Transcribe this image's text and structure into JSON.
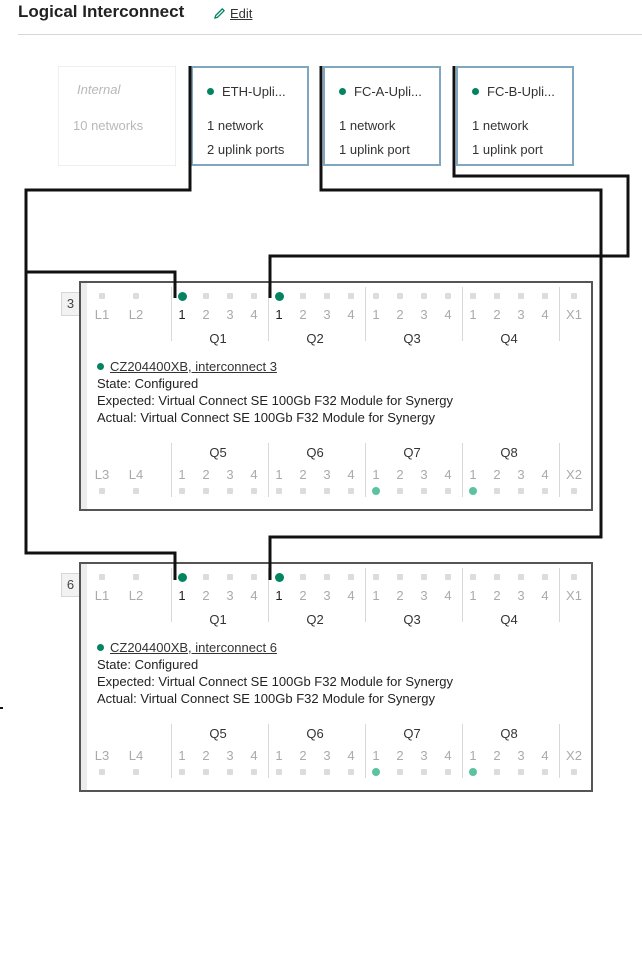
{
  "header": {
    "title": "Logical Interconnect",
    "edit_label": "Edit",
    "edit_icon": "pencil-icon"
  },
  "colors": {
    "status_ok": "#01845f",
    "uplink_tile_border": "#7fa7c0",
    "port_linked_light": "#5cc2a0",
    "wire": "#111111"
  },
  "uplink_sets": [
    {
      "name": "Internal",
      "networks": "10 networks",
      "ports": "",
      "type": "internal"
    },
    {
      "name": "ETH-Upli...",
      "networks": "1 network",
      "ports": "2 uplink ports",
      "status": "ok"
    },
    {
      "name": "FC-A-Upli...",
      "networks": "1 network",
      "ports": "1 uplink port",
      "status": "ok"
    },
    {
      "name": "FC-B-Upli...",
      "networks": "1 network",
      "ports": "1 uplink port",
      "status": "ok"
    }
  ],
  "modules": [
    {
      "slot": "3",
      "name": "CZ204400XB, interconnect 3",
      "state": "State: Configured",
      "expected": "Expected: Virtual Connect SE 100Gb F32 Module for Synergy",
      "actual": "Actual: Virtual Connect SE 100Gb F32 Module for Synergy",
      "top_groups": {
        "L1": "L1",
        "L2": "L2",
        "Q1": "Q1",
        "Q2": "Q2",
        "Q3": "Q3",
        "Q4": "Q4",
        "X1": "X1"
      },
      "bottom_groups": {
        "L3": "L3",
        "L4": "L4",
        "Q5": "Q5",
        "Q6": "Q6",
        "Q7": "Q7",
        "Q8": "Q8",
        "X2": "X2"
      },
      "uplinked_ports": [
        "Q1:1",
        "Q2:1"
      ],
      "linked_ports": [
        "Q7:1",
        "Q8:1"
      ]
    },
    {
      "slot": "6",
      "name": "CZ204400XB, interconnect 6",
      "state": "State: Configured",
      "expected": "Expected: Virtual Connect SE 100Gb F32 Module for Synergy",
      "actual": "Actual: Virtual Connect SE 100Gb F32 Module for Synergy",
      "top_groups": {
        "L1": "L1",
        "L2": "L2",
        "Q1": "Q1",
        "Q2": "Q2",
        "Q3": "Q3",
        "Q4": "Q4",
        "X1": "X1"
      },
      "bottom_groups": {
        "L3": "L3",
        "L4": "L4",
        "Q5": "Q5",
        "Q6": "Q6",
        "Q7": "Q7",
        "Q8": "Q8",
        "X2": "X2"
      },
      "uplinked_ports": [
        "Q1:1",
        "Q2:1"
      ],
      "linked_ports": [
        "Q7:1",
        "Q8:1"
      ]
    }
  ],
  "port_numbers": [
    "1",
    "2",
    "3",
    "4"
  ],
  "connections": [
    {
      "uplink_set": "ETH-Upli...",
      "to": [
        "interconnect 3 Q1:1",
        "interconnect 6 Q1:1"
      ]
    },
    {
      "uplink_set": "FC-A-Upli...",
      "to": [
        "interconnect 6 Q2:1"
      ]
    },
    {
      "uplink_set": "FC-B-Upli...",
      "to": [
        "interconnect 3 Q2:1"
      ]
    }
  ]
}
